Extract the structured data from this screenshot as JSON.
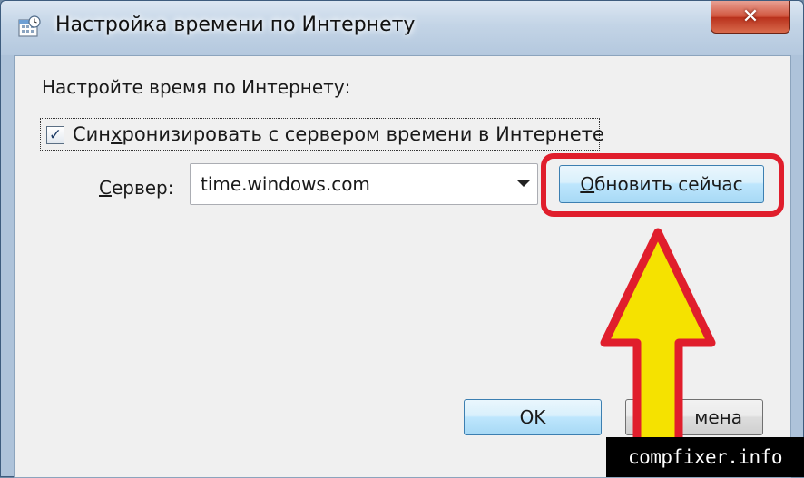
{
  "window": {
    "title": "Настройка времени по Интернету",
    "close_label": "✕"
  },
  "dialog": {
    "heading": "Настройте время по Интернету:",
    "sync_checkbox": {
      "label_prefix": "Син",
      "label_mnemonic": "х",
      "label_suffix": "ронизировать с сервером времени в Интернете",
      "checked": true
    },
    "server_label_mnemonic": "С",
    "server_label_rest": "ервер:",
    "server_value": "time.windows.com",
    "update_button_mnemonic": "О",
    "update_button_rest": "бновить сейчас",
    "ok_label": "OK",
    "cancel_label_visible": "мена"
  },
  "overlay": {
    "highlight_color": "#e01e2c",
    "arrow_color": "#f5e200",
    "arrow_outline_color": "#e01e2c"
  },
  "watermark": {
    "text": "compfixer.info"
  }
}
